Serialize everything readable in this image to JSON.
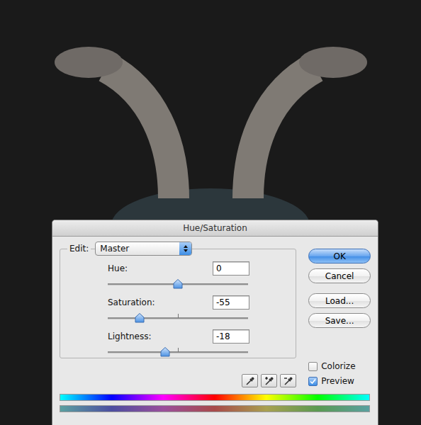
{
  "window": {
    "title": "Hue/Saturation"
  },
  "edit": {
    "label": "Edit:",
    "value": "Master"
  },
  "sliders": [
    {
      "label": "Hue:",
      "value": "0",
      "level": 0.5,
      "center_mark": false
    },
    {
      "label": "Saturation:",
      "value": "-55",
      "level": 0.225,
      "center_mark": true
    },
    {
      "label": "Lightness:",
      "value": "-18",
      "level": 0.41,
      "center_mark": true
    }
  ],
  "buttons": [
    {
      "label": "OK",
      "default": true
    },
    {
      "label": "Cancel",
      "default": false
    },
    {
      "label": "Load...",
      "default": false
    },
    {
      "label": "Save...",
      "default": false
    }
  ],
  "eyedroppers": [
    {
      "kind": "sample"
    },
    {
      "kind": "add"
    },
    {
      "kind": "subtract"
    }
  ],
  "checkboxes": [
    {
      "label": "Colorize",
      "checked": false
    },
    {
      "label": "Preview",
      "checked": true
    }
  ],
  "color_bars": [
    {
      "kind": "input"
    },
    {
      "kind": "output"
    }
  ]
}
